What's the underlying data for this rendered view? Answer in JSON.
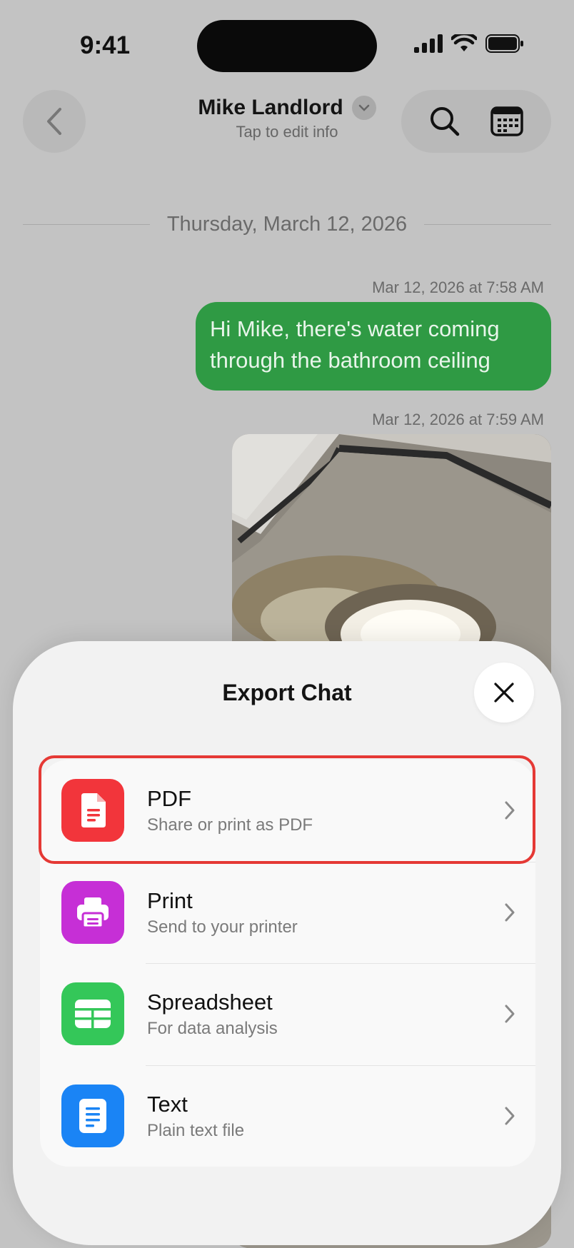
{
  "status_bar": {
    "time": "9:41"
  },
  "header": {
    "contact_name": "Mike Landlord",
    "subtitle": "Tap to edit info"
  },
  "chat": {
    "date_divider": "Thursday, March 12, 2026",
    "messages": [
      {
        "timestamp": "Mar 12, 2026 at 7:58 AM",
        "text": "Hi Mike, there's water coming through the bathroom ceiling"
      },
      {
        "timestamp": "Mar 12, 2026 at 7:59 AM",
        "type": "photo"
      }
    ]
  },
  "export_sheet": {
    "title": "Export Chat",
    "options": [
      {
        "title": "PDF",
        "subtitle": "Share or print as PDF",
        "color": "#f2353b",
        "icon": "document-icon"
      },
      {
        "title": "Print",
        "subtitle": "Send to your printer",
        "color": "#c62fd6",
        "icon": "printer-icon"
      },
      {
        "title": "Spreadsheet",
        "subtitle": "For data analysis",
        "color": "#34c759",
        "icon": "table-icon"
      },
      {
        "title": "Text",
        "subtitle": "Plain text file",
        "color": "#1a84f5",
        "icon": "text-file-icon"
      }
    ],
    "highlighted_option": "PDF"
  }
}
